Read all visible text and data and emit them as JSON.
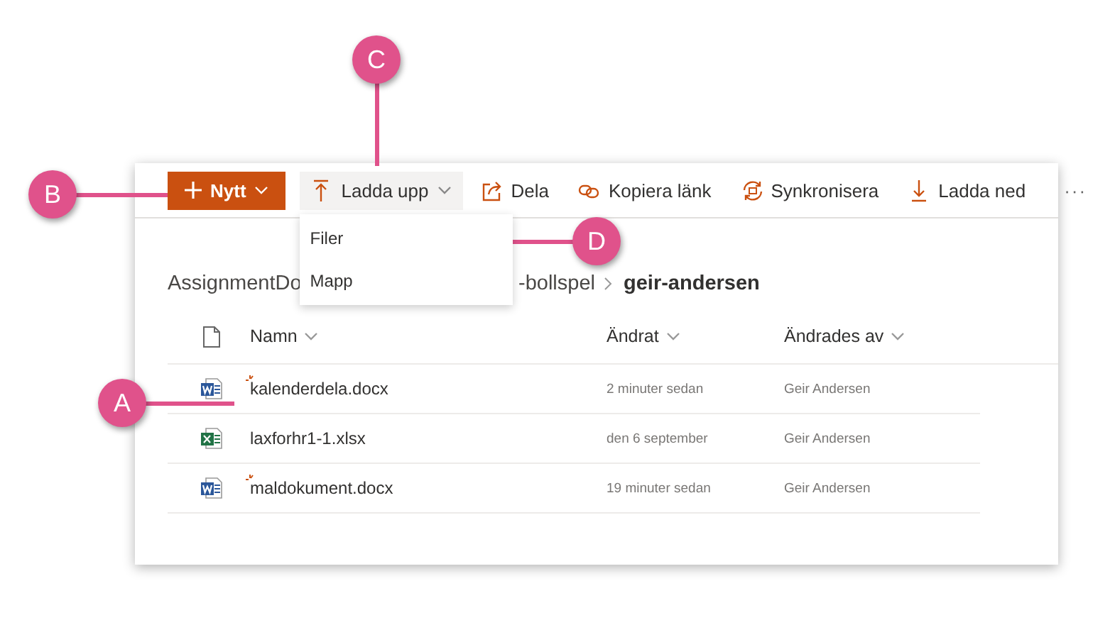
{
  "toolbar": [
    {
      "kind": "primary",
      "label": "Nytt"
    },
    {
      "kind": "upload",
      "label": "Ladda upp",
      "expanded": true
    },
    {
      "kind": "share",
      "label": "Dela"
    },
    {
      "kind": "link",
      "label": "Kopiera länk"
    },
    {
      "kind": "sync",
      "label": "Synkronisera"
    },
    {
      "kind": "download",
      "label": "Ladda ned"
    },
    {
      "kind": "more",
      "label": "···"
    }
  ],
  "upload_menu": [
    "Filer",
    "Mapp"
  ],
  "breadcrumb": [
    "AssignmentDo",
    "-bollspel",
    "geir-andersen"
  ],
  "table": {
    "columns": [
      "Namn",
      "Ändrat",
      "Ändrades av"
    ],
    "rows": [
      {
        "kind": "word",
        "new": true,
        "name": "kalenderdela.docx",
        "modified": "2 minuter sedan",
        "modified_by": "Geir Andersen"
      },
      {
        "kind": "excel",
        "new": false,
        "name": "laxforhr1-1.xlsx",
        "modified": "den 6 september",
        "modified_by": "Geir Andersen"
      },
      {
        "kind": "word",
        "new": true,
        "name": "maldokument.docx",
        "modified": "19 minuter sedan",
        "modified_by": "Geir Andersen"
      }
    ]
  },
  "callouts": [
    {
      "label": "A"
    },
    {
      "label": "B"
    },
    {
      "label": "C"
    },
    {
      "label": "D"
    }
  ]
}
